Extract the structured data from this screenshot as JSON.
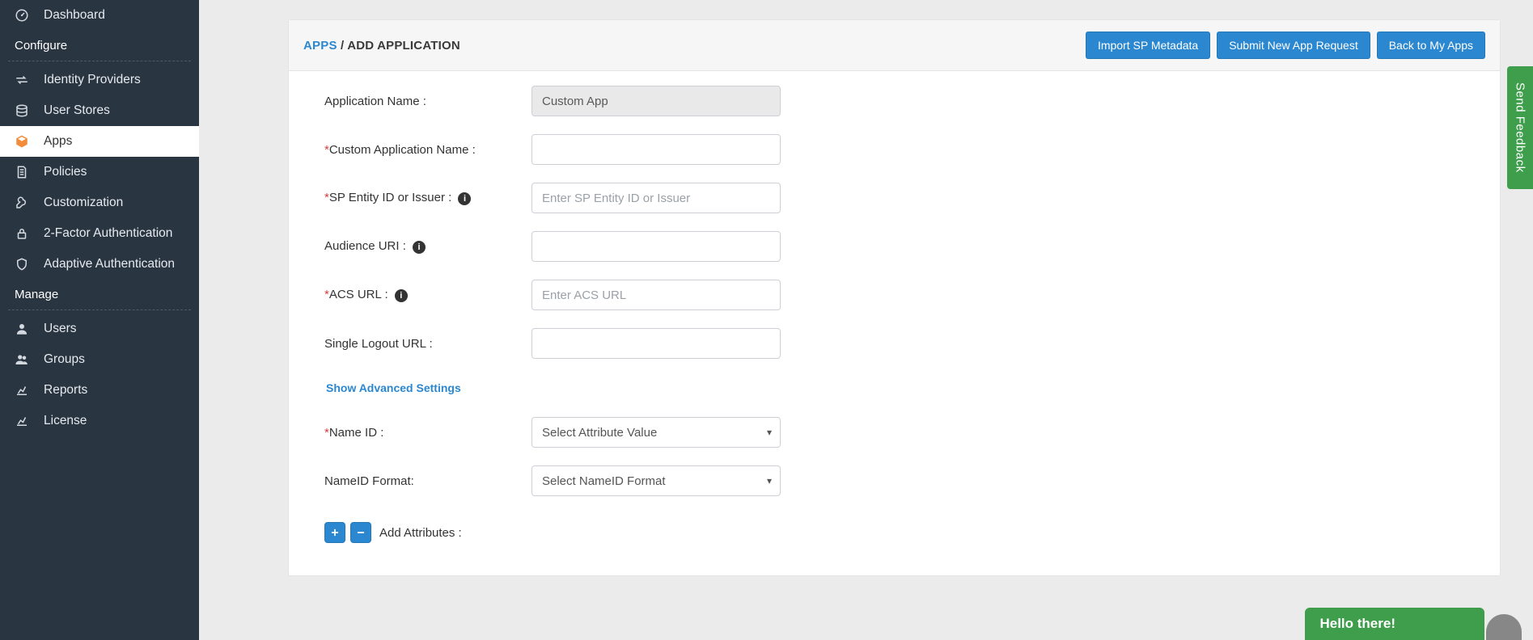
{
  "sidebar": {
    "items": [
      {
        "label": "Dashboard"
      }
    ],
    "configure_label": "Configure",
    "configure_items": [
      {
        "label": "Identity Providers"
      },
      {
        "label": "User Stores"
      },
      {
        "label": "Apps",
        "active": true
      },
      {
        "label": "Policies"
      },
      {
        "label": "Customization"
      },
      {
        "label": "2-Factor Authentication"
      },
      {
        "label": "Adaptive Authentication"
      }
    ],
    "manage_label": "Manage",
    "manage_items": [
      {
        "label": "Users"
      },
      {
        "label": "Groups"
      },
      {
        "label": "Reports"
      },
      {
        "label": "License"
      }
    ]
  },
  "header": {
    "breadcrumb_apps": "APPS",
    "breadcrumb_sep": " / ",
    "breadcrumb_current": "ADD APPLICATION",
    "buttons": {
      "import_sp": "Import SP Metadata",
      "submit_req": "Submit New App Request",
      "back_apps": "Back to My Apps"
    }
  },
  "form": {
    "app_name_label": "Application Name :",
    "app_name_value": "Custom App",
    "custom_app_label": "Custom Application Name :",
    "custom_app_value": "",
    "sp_entity_label": "SP Entity ID or Issuer :",
    "sp_entity_placeholder": "Enter SP Entity ID or Issuer",
    "audience_label": "Audience URI :",
    "audience_value": "",
    "acs_label": "ACS URL :",
    "acs_placeholder": "Enter ACS URL",
    "slo_label": "Single Logout URL :",
    "slo_value": "",
    "advanced_link": "Show Advanced Settings",
    "nameid_label": "Name ID :",
    "nameid_value": "Select Attribute Value",
    "nameid_format_label": "NameID Format:",
    "nameid_format_value": "Select NameID Format",
    "add_attr_label": "Add Attributes :"
  },
  "feedback_tab": "Send Feedback",
  "chat_head": "Hello there!"
}
